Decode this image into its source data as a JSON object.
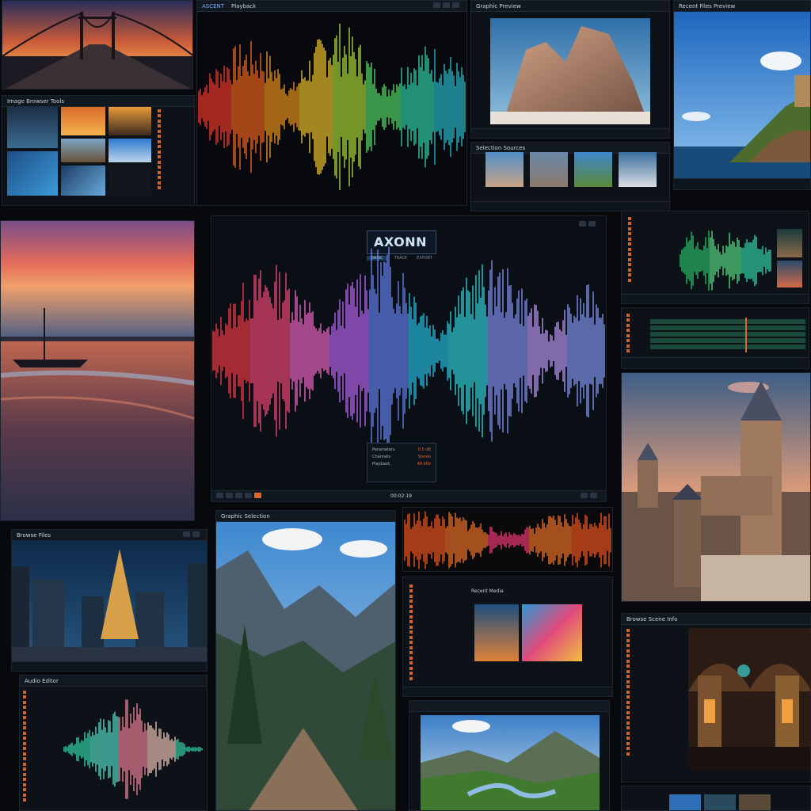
{
  "brand": {
    "logo_text": "AXONN"
  },
  "center_panel": {
    "toolbar": [
      "BASIC",
      "TRACK",
      "EXPORT"
    ],
    "info_rows": [
      {
        "label": "Parameters",
        "value": "0.5 dB"
      },
      {
        "label": "Channels",
        "value": "Stereo"
      },
      {
        "label": "Playback",
        "value": "48 kHz"
      }
    ],
    "footer_time": "00:02:19"
  },
  "panels": {
    "top_waveform_title": "ASCENT",
    "top_waveform_menu": "Playback",
    "photo_grid_title": "Image Browser Tools",
    "rock_title": "Graphic Preview",
    "thumb_strip_title": "Selection Sources",
    "coast_title": "Recent Files Preview",
    "city_title": "Browse Files",
    "waveform_small_title": "Audio Editor",
    "mountain_title": "Graphic Selection",
    "media_title": "Recent Media",
    "hall_title": "Browse Scene Info"
  },
  "colors": {
    "accent": "#e0662a",
    "primary": "#2f7be0",
    "panel": "#0d1219",
    "background": "#07090d"
  }
}
